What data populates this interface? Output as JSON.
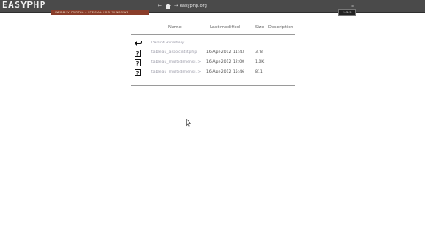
{
  "header": {
    "logo": "EASYPHP",
    "tagline": "WEBDEV PORTAL - SPECIAL FOR WINDOWS",
    "back_control": "←",
    "forward_control": "→",
    "breadcrumb": "→ easyphp.org",
    "user": "☰ ",
    "version": "5.3.9"
  },
  "listing": {
    "columns": {
      "name": "Name",
      "modified": "Last modified",
      "size": "Size",
      "description": "Description"
    },
    "parent": {
      "label": "Parent Directory",
      "icon": "back-arrow-icon"
    },
    "rows": [
      {
        "name": "tableau_associatif.php",
        "modified": "16-Apr-2012 11:43",
        "size": "378",
        "icon": "unknown-file-icon"
      },
      {
        "name": "tableau_multidimensi..>",
        "modified": "16-Apr-2012 12:00",
        "size": "1.0K",
        "icon": "unknown-file-icon"
      },
      {
        "name": "tableau_multidimensi..>",
        "modified": "16-Apr-2012 15:46",
        "size": "811",
        "icon": "unknown-file-icon"
      }
    ]
  }
}
